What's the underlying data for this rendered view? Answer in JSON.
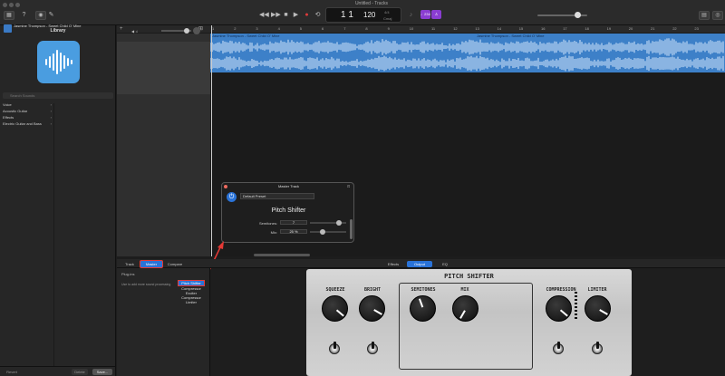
{
  "window": {
    "title": "Untitled - Tracks"
  },
  "transport": {
    "lcd_bar_beat": "1  1",
    "lcd_tempo": "120",
    "lcd_sig_top": "4/4",
    "lcd_key": "Cmaj",
    "count_in_label": "♩234",
    "mode_icon": "tuner-icon"
  },
  "library": {
    "title": "Library",
    "search_placeholder": "Search Sounds",
    "items": [
      {
        "label": "Voice"
      },
      {
        "label": "Acoustic Guitar"
      },
      {
        "label": "Effects"
      },
      {
        "label": "Electric Guitar and Bass"
      }
    ],
    "revert_label": "Revert",
    "delete_label": "Delete",
    "save_label": "Save..."
  },
  "track": {
    "name": "Jasmine Thompson - Sweet Child O' Mine",
    "region_left": "Jasmine Thompson - Sweet Child O' Mine",
    "region_right": "Jasmine Thompson - Sweet Child O' Mine"
  },
  "ruler": {
    "ticks": [
      "1",
      "2",
      "3",
      "4",
      "5",
      "6",
      "7",
      "8",
      "9",
      "10",
      "11",
      "12",
      "13",
      "14",
      "15",
      "16",
      "17",
      "18",
      "19",
      "20",
      "21",
      "22",
      "23"
    ]
  },
  "plugin_window": {
    "title": "Master Track",
    "preset": "Default Preset",
    "heading": "Pitch Shifter",
    "semitones_label": "Semitones:",
    "semitones_value": "7",
    "mix_label": "Mix:",
    "mix_value": "25 %"
  },
  "smart_controls": {
    "tabs_left": [
      "Track",
      "Master",
      "Compare"
    ],
    "tabs_right": [
      "Effects",
      "Output",
      "EQ"
    ],
    "plugins_heading": "Plug-ins",
    "plugins_hint": "Use to add more sound processing",
    "plugin_list": [
      "Pitch Shifter",
      "Compressor",
      "Exciter",
      "Compressor",
      "Limiter"
    ]
  },
  "pedal": {
    "title": "PITCH SHIFTER",
    "knobs": [
      "SQUEEZE",
      "BRIGHT",
      "SEMITONES",
      "MIX",
      "COMPRESSION",
      "LIMITER"
    ]
  },
  "colors": {
    "accent": "#3d80c8",
    "purple": "#8a3dd1",
    "highlight": "#e53935"
  }
}
